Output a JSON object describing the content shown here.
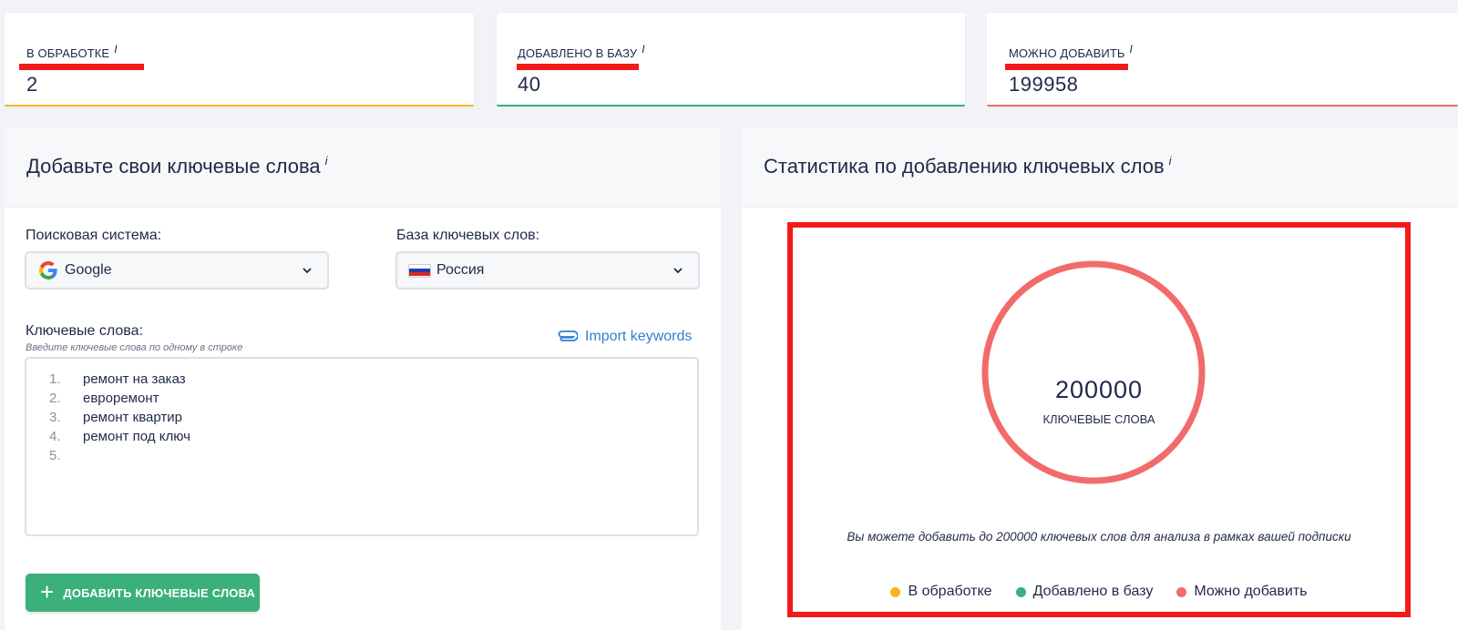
{
  "stats": [
    {
      "label": "В ОБРАБОТКЕ",
      "info": "i",
      "value": "2",
      "color": "#f3b61f"
    },
    {
      "label": "ДОБАВЛЕНО В БАЗУ",
      "info": "i",
      "value": "40",
      "color": "#3bb07a"
    },
    {
      "label": "МОЖНО ДОБАВИТЬ",
      "info": "i",
      "value": "199958",
      "color": "#f26b6b"
    }
  ],
  "left_panel": {
    "title": "Добавьте свои ключевые слова",
    "info": "i",
    "engine_label": "Поисковая система:",
    "engine_value": "Google",
    "engine_icon": "google-icon",
    "db_label": "База ключевых слов:",
    "db_value": "Россия",
    "db_icon": "russia-flag-icon",
    "keywords_label": "Ключевые слова:",
    "keywords_hint": "Введите ключевые слова по одному в строке",
    "import_label": "Import keywords",
    "keywords": [
      {
        "num": "1.",
        "text": "ремонт на заказ"
      },
      {
        "num": "2.",
        "text": "евроремонт"
      },
      {
        "num": "3.",
        "text": "ремонт квартир"
      },
      {
        "num": "4.",
        "text": "ремонт под ключ"
      },
      {
        "num": "5.",
        "text": ""
      }
    ],
    "add_button": "ДОБАВИТЬ КЛЮЧЕВЫЕ СЛОВА"
  },
  "right_panel": {
    "title": "Статистика по добавлению ключевых слов",
    "info": "i",
    "total": "200000",
    "total_label": "КЛЮЧЕВЫЕ СЛОВА",
    "note": "Вы можете добавить до 200000 ключевых слов для анализа в рамках вашей подписки",
    "legend": [
      {
        "label": "В обработке",
        "color": "#f3b61f"
      },
      {
        "label": "Добавлено в базу",
        "color": "#3bb07a"
      },
      {
        "label": "Можно добавить",
        "color": "#f26b6b"
      }
    ]
  },
  "chart_data": {
    "type": "pie",
    "categories": [
      "В обработке",
      "Добавлено в базу",
      "Можно добавить"
    ],
    "values": [
      2,
      40,
      199958
    ],
    "colors": [
      "#f3b61f",
      "#3bb07a",
      "#f26b6b"
    ],
    "center_text": "200000",
    "center_subtext": "КЛЮЧЕВЫЕ СЛОВА"
  }
}
